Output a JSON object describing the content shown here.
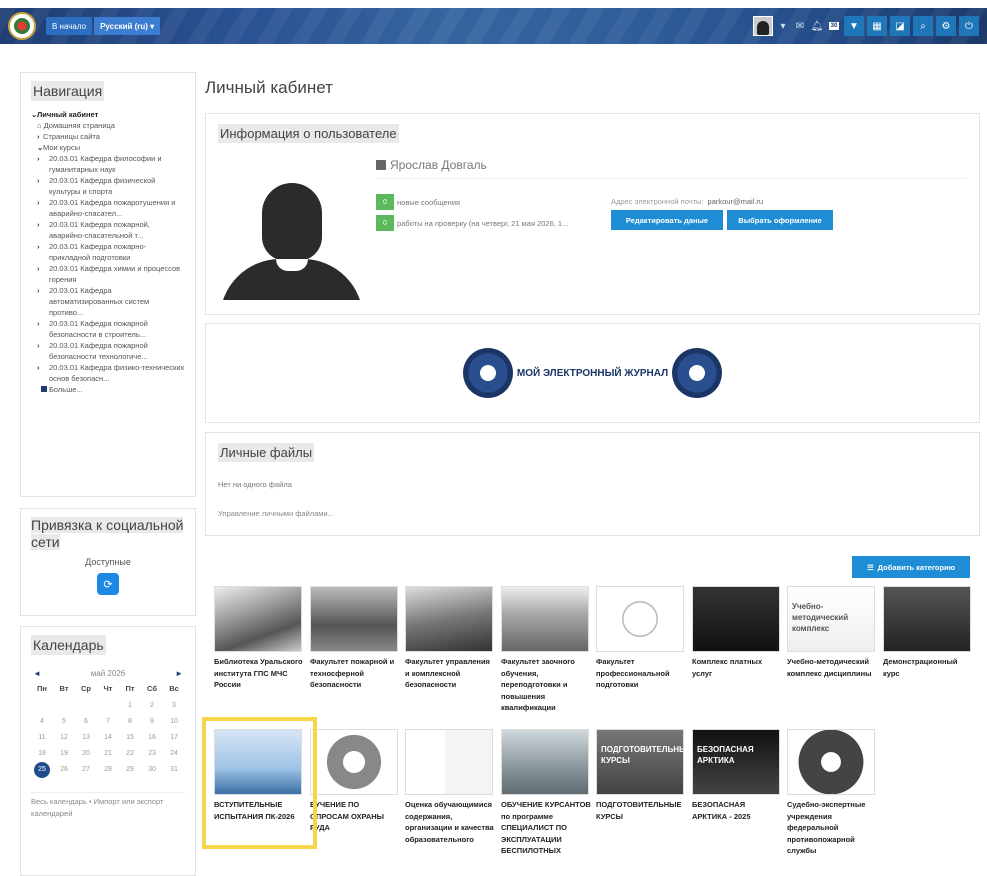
{
  "navbar": {
    "home_label": "В начало",
    "lang_label": "Русский (ru)",
    "badge": "30"
  },
  "nav": {
    "title": "Навигация",
    "root": "Личный кабинет",
    "home": "Домашняя страница",
    "site_pages": "Страницы сайта",
    "my_courses": "Мои курсы",
    "courses": [
      "20.03.01 Кафедра философии и гуманитарных наук",
      "20.03.01 Кафедра физической культуры и спорта",
      "20.03.01 Кафедра пожаротушения и аварийно-спасател...",
      "20.03.01 Кафедра пожарной, аварийно-спасательной т...",
      "20.03.01 Кафедра пожарно-прикладной подготовки",
      "20.03.01 Кафедра химии и процессов горения",
      "20.03.01 Кафедра автоматизированных систем противо...",
      "20.03.01 Кафедра пожарной безопасности в строитель...",
      "20.03.01 Кафедра пожарной безопасности технологиче...",
      "20.03.01 Кафедра физико-технических основ безопасн..."
    ],
    "more": "Больше..."
  },
  "social": {
    "title": "Привязка к социальной сети",
    "available": "Доступные"
  },
  "calendar": {
    "title": "Календарь",
    "month": "май 2026",
    "dows": [
      "Пн",
      "Вт",
      "Ср",
      "Чт",
      "Пт",
      "Сб",
      "Вс"
    ],
    "days": [
      "",
      "",
      "",
      "",
      "1",
      "2",
      "3",
      "4",
      "5",
      "6",
      "7",
      "8",
      "9",
      "10",
      "11",
      "12",
      "13",
      "14",
      "15",
      "16",
      "17",
      "18",
      "19",
      "20",
      "21",
      "22",
      "23",
      "24",
      "25",
      "26",
      "27",
      "28",
      "29",
      "30",
      "31"
    ],
    "today": "25",
    "footer": "Весь календарь • Импорт или экспорт календарей"
  },
  "page_title": "Личный кабинет",
  "user": {
    "section_title": "Информация о пользователе",
    "name": "Ярослав Довгаль",
    "new_messages_count": "0",
    "new_messages_label": "новые сообщения",
    "to_review_count": "0",
    "to_review_label": "работы на проверку (на четверг, 21 мая 2026, 1...",
    "email_label": "Адрес электронной почты:",
    "email": "parkour@mail.ru",
    "edit_button": "Редактировать даные",
    "theme_button": "Выбрать оформление"
  },
  "journal": {
    "label": "МОЙ ЭЛЕКТРОННЫЙ ЖУРНАЛ"
  },
  "files": {
    "title": "Личные файлы",
    "empty": "Нет ни одного файла",
    "manage": "Управление личными файлами..."
  },
  "add_category": "Добавить категорию",
  "categories": [
    {
      "label": "Библиотека Уральского института ГПС МЧС России",
      "img_text": ""
    },
    {
      "label": "Факультет пожарной и техносферной безопасности",
      "img_text": ""
    },
    {
      "label": "Факультет управления и комплексной безопасности",
      "img_text": ""
    },
    {
      "label": "Факультет заочного обучения, переподготовки и повышения квалификации",
      "img_text": ""
    },
    {
      "label": "Факультет профессиональной подготовки",
      "img_text": ""
    },
    {
      "label": "Комплекс платных услуг",
      "img_text": ""
    },
    {
      "label": "Учебно-методический комплекс дисциплины",
      "img_text": "Учебно-методический комплекс"
    },
    {
      "label": "Демонстрационный курс",
      "img_text": ""
    },
    {
      "label": "ВСТУПИТЕЛЬНЫЕ ИСПЫТАНИЯ ПК-2026",
      "img_text": ""
    },
    {
      "label": "БУЧЕНИЕ ПО ОПРОСАМ ОХРАНЫ РУДА",
      "img_text": ""
    },
    {
      "label": "Оценка обучающимися содержания, организации и качества образовательного",
      "img_text": ""
    },
    {
      "label": "ОБУЧЕНИЕ КУРСАНТОВ по программе СПЕЦИАЛИСТ ПО ЭКСПЛУАТАЦИИ БЕСПИЛОТНЫХ",
      "img_text": ""
    },
    {
      "label": "ПОДГОТОВИТЕЛЬНЫЕ КУРСЫ",
      "img_text": "ПОДГОТОВИТЕЛЬНЫЕ КУРСЫ"
    },
    {
      "label": "БЕЗОПАСНАЯ АРКТИКА - 2025",
      "img_text": "БЕЗОПАСНАЯ АРКТИКА"
    },
    {
      "label": "Судебно-экспертные учреждения федеральной противопожарной службы",
      "img_text": ""
    }
  ],
  "colors": {
    "accent": "#1f8dd6",
    "success": "#5cb85c",
    "highlight": "#f5d54b"
  }
}
